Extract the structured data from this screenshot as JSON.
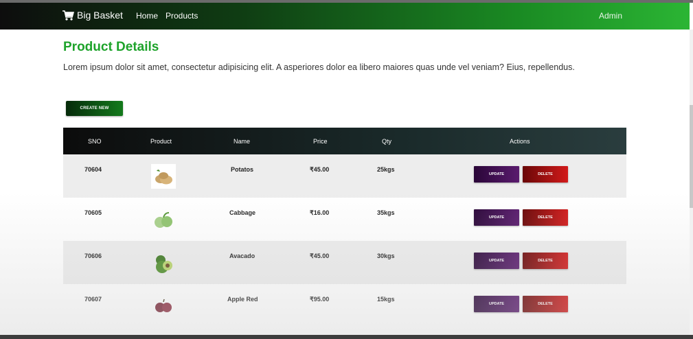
{
  "navbar": {
    "brand": "Big Basket",
    "links": [
      "Home",
      "Products"
    ],
    "user": "Admin"
  },
  "page": {
    "title": "Product Details",
    "description": "Lorem ipsum dolor sit amet, consectetur adipisicing elit. A asperiores dolor ea libero maiores quas unde vel veniam? Eius, repellendus.",
    "create_button": "CREATE NEW"
  },
  "table": {
    "headers": [
      "SNO",
      "Product",
      "Name",
      "Price",
      "Qty",
      "Actions"
    ],
    "rows": [
      {
        "sno": "70604",
        "name": "Potatos",
        "price": "₹45.00",
        "qty": "25kgs",
        "image": "potato-image"
      },
      {
        "sno": "70605",
        "name": "Cabbage",
        "price": "₹16.00",
        "qty": "35kgs",
        "image": "cabbage-image"
      },
      {
        "sno": "70606",
        "name": "Avacado",
        "price": "₹45.00",
        "qty": "30kgs",
        "image": "avocado-image"
      },
      {
        "sno": "70607",
        "name": "Apple Red",
        "price": "₹95.00",
        "qty": "15kgs",
        "image": "apple-image"
      }
    ],
    "update_label": "UPDATE",
    "delete_label": "DELETE"
  },
  "colors": {
    "accent_green": "#1ea32b",
    "update_purple": "#5a1b6e",
    "delete_red": "#d21a1a"
  }
}
